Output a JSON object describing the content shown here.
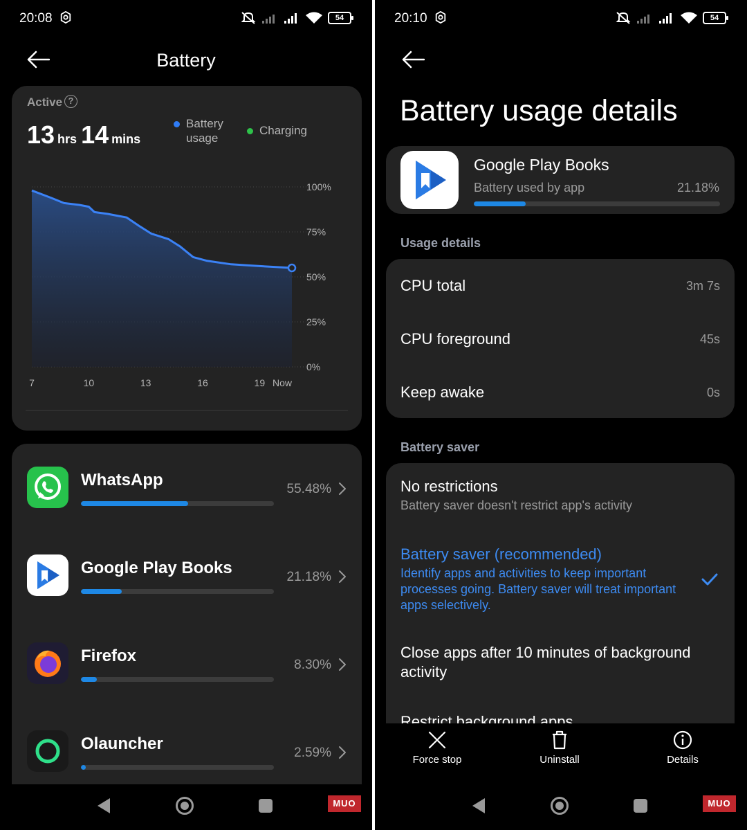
{
  "left": {
    "status": {
      "time": "20:08",
      "battery": "54"
    },
    "header": {
      "title": "Battery"
    },
    "summary": {
      "active_label": "Active",
      "help_glyph": "?",
      "hours": "13",
      "hours_unit": "hrs",
      "minutes": "14",
      "minutes_unit": "mins",
      "legend_battery": "Battery usage",
      "legend_charging": "Charging",
      "color_battery": "#2f7cf6",
      "color_charging": "#2ec24a"
    },
    "apps": [
      {
        "name": "WhatsApp",
        "percent": "55.48%",
        "fraction": 0.5548,
        "icon": "whatsapp-icon"
      },
      {
        "name": "Google Play Books",
        "percent": "21.18%",
        "fraction": 0.2118,
        "icon": "play-books-icon"
      },
      {
        "name": "Firefox",
        "percent": "8.30%",
        "fraction": 0.083,
        "icon": "firefox-icon"
      },
      {
        "name": "Olauncher",
        "percent": "2.59%",
        "fraction": 0.0259,
        "icon": "olauncher-icon"
      }
    ],
    "watermark": "MUO"
  },
  "chart_data": {
    "type": "area",
    "title": "",
    "xlabel": "",
    "ylabel": "",
    "x_ticks": [
      "7",
      "10",
      "13",
      "16",
      "19",
      "Now"
    ],
    "y_ticks": [
      "100%",
      "75%",
      "50%",
      "25%",
      "0%"
    ],
    "ylim": [
      0,
      100
    ],
    "series": [
      {
        "name": "Battery usage",
        "x": [
          7,
          8,
          8.7,
          9.5,
          10,
          10.3,
          11,
          11.5,
          12,
          12.7,
          13.3,
          14.2,
          14.8,
          15.5,
          16.2,
          17.5,
          19,
          20.7
        ],
        "values": [
          98,
          94,
          91,
          90,
          89,
          86,
          85,
          84,
          83,
          78,
          74,
          71,
          67,
          61,
          59,
          57,
          56,
          55
        ]
      }
    ],
    "grid": true,
    "legend_position": "top-right"
  },
  "right": {
    "status": {
      "time": "20:10",
      "battery": "54"
    },
    "page_title": "Battery usage details",
    "app": {
      "name": "Google Play Books",
      "sub": "Battery used by app",
      "percent": "21.18%",
      "fraction": 0.2118
    },
    "usage_head": "Usage details",
    "usage": [
      {
        "label": "CPU total",
        "value": "3m 7s"
      },
      {
        "label": "CPU foreground",
        "value": "45s"
      },
      {
        "label": "Keep awake",
        "value": "0s"
      }
    ],
    "saver_head": "Battery saver",
    "options": [
      {
        "title": "No restrictions",
        "desc": "Battery saver doesn't restrict app's activity",
        "selected": false
      },
      {
        "title": "Battery saver (recommended)",
        "desc": "Identify apps and activities to keep important processes going. Battery saver will treat important apps selectively.",
        "selected": true
      },
      {
        "title": "Close apps after 10 minutes of background activity",
        "desc": "",
        "selected": false
      },
      {
        "title": "Restrict background apps",
        "desc": "",
        "selected": false
      }
    ],
    "actions": {
      "force_stop": "Force stop",
      "uninstall": "Uninstall",
      "details": "Details"
    },
    "watermark": "MUO",
    "accent": "#3d8bf2"
  }
}
